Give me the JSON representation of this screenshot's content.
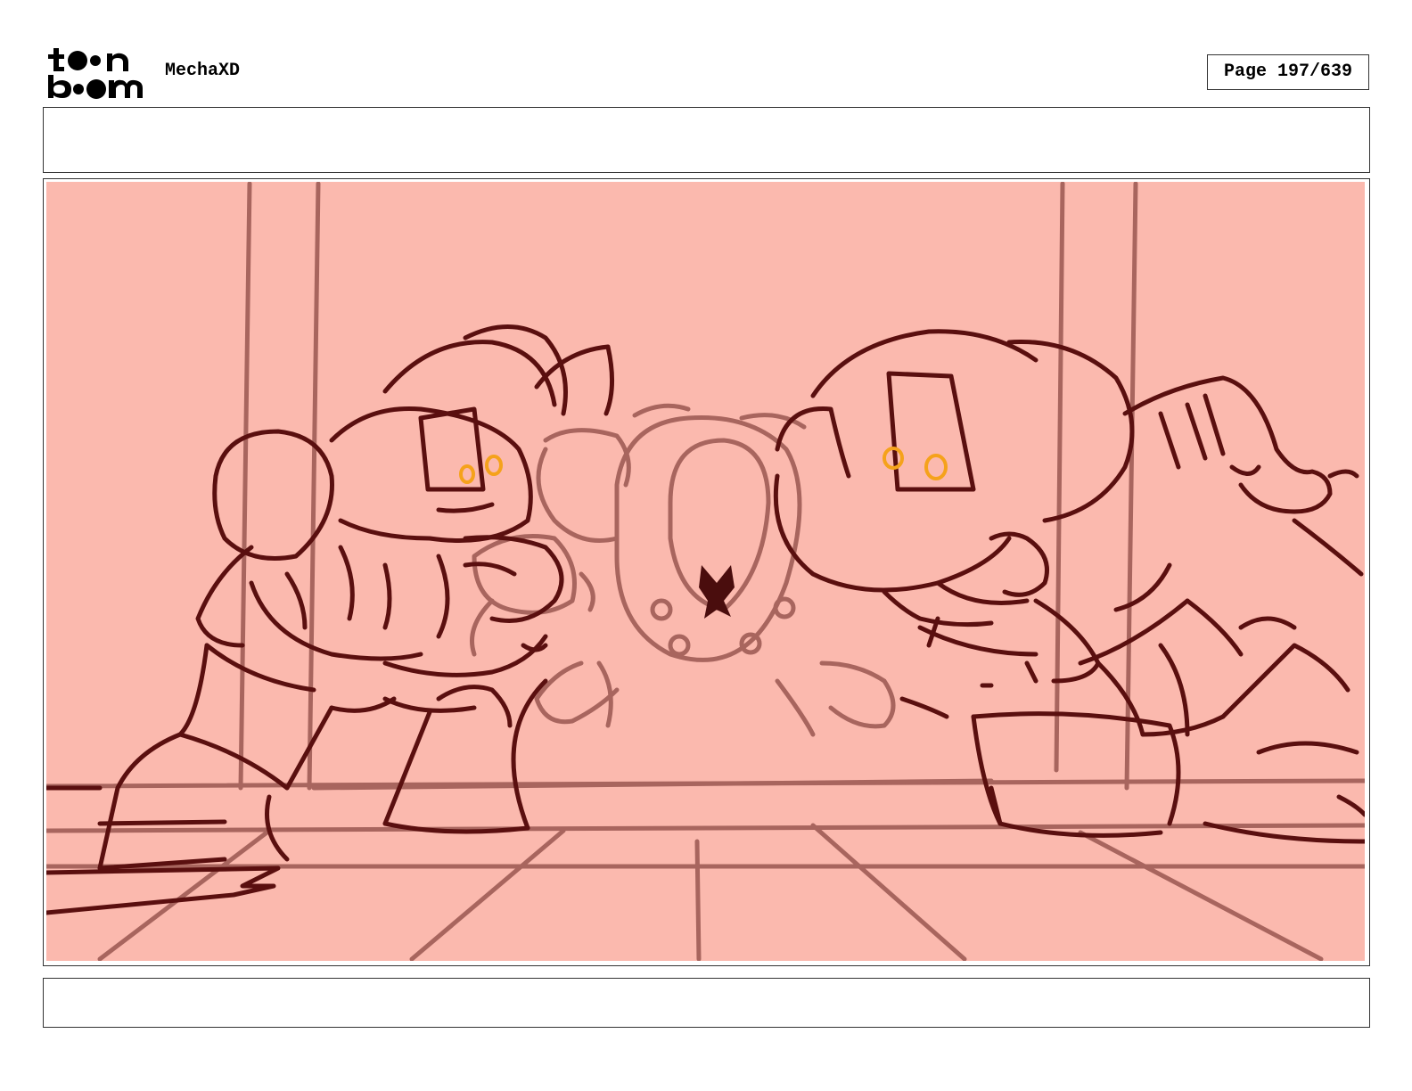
{
  "header": {
    "logo_alt": "toon boom",
    "project_title": "MechaXD",
    "page_counter": "Page 197/639"
  },
  "panel": {
    "background_color": "#fbb9ae",
    "line_dark": "#5a0f0f",
    "line_light": "#a8655e",
    "eye_color": "#f5a21b"
  },
  "notes": {
    "top": "",
    "bottom": ""
  }
}
